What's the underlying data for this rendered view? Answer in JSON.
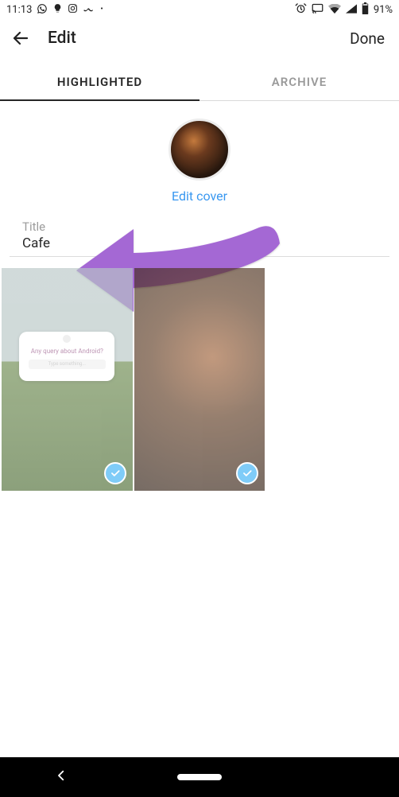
{
  "status": {
    "time": "11:13",
    "battery": "91%"
  },
  "header": {
    "title": "Edit",
    "done": "Done"
  },
  "tabs": {
    "highlighted": "HIGHLIGHTED",
    "archive": "ARCHIVE"
  },
  "cover": {
    "edit_label": "Edit cover"
  },
  "title_field": {
    "label": "Title",
    "value": "Cafe"
  },
  "grid": {
    "query_text": "Any query about Android?",
    "query_placeholder": "Type something..."
  }
}
